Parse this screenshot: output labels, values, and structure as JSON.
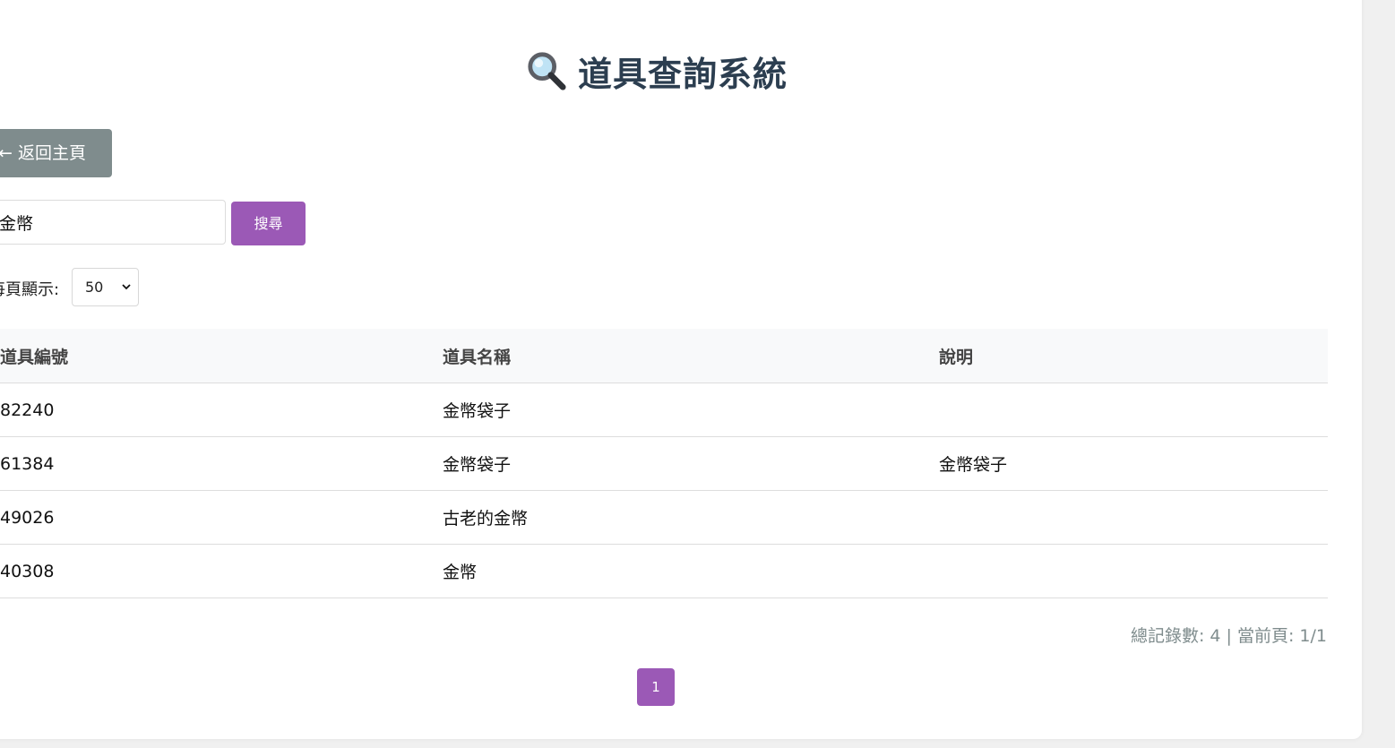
{
  "header": {
    "title": "道具查詢系統",
    "icon": "magnifying-glass-icon"
  },
  "nav": {
    "back_label": "← 返回主頁"
  },
  "search": {
    "value": "金幣",
    "button_label": "搜尋"
  },
  "paging_options": {
    "per_page_label": "每頁顯示:",
    "per_page_value": "50"
  },
  "table": {
    "headers": [
      "道具編號",
      "道具名稱",
      "說明"
    ],
    "rows": [
      [
        "82240",
        "金幣袋子",
        ""
      ],
      [
        "61384",
        "金幣袋子",
        "金幣袋子"
      ],
      [
        "49026",
        "古老的金幣",
        ""
      ],
      [
        "40308",
        "金幣",
        ""
      ]
    ]
  },
  "summary": {
    "text": "總記錄數: 4 | 當前頁: 1/1"
  },
  "pagination": {
    "current_page": "1"
  },
  "colors": {
    "accent": "#9b59b6",
    "back_button": "#7f8c8d",
    "title": "#2c3e50",
    "header_bg": "#f8f9fa"
  }
}
